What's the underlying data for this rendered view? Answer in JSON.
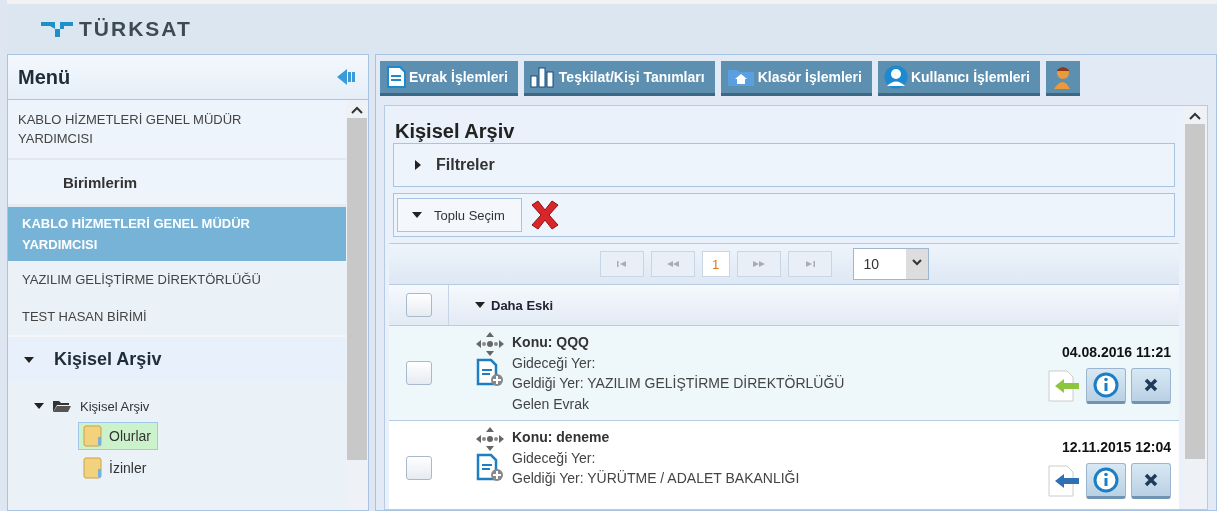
{
  "header": {
    "logo": "TÜRKSAT"
  },
  "sidebar": {
    "title": "Menü",
    "top_item": "KABLO HİZMETLERİ GENEL MÜDÜR YARDIMCISI",
    "units_title": "Birimlerim",
    "units": [
      {
        "label": "KABLO HİZMETLERİ GENEL MÜDÜR YARDIMCISI",
        "selected": true
      },
      {
        "label": "YAZILIM GELİŞTİRME DİREKTÖRLÜĞÜ",
        "selected": false
      },
      {
        "label": "TEST HASAN BİRİMİ",
        "selected": false
      }
    ],
    "archive": {
      "title": "Kişisel Arşiv",
      "expanded": true
    },
    "tree": [
      {
        "label": "Kişisel Arşiv",
        "expanded": true,
        "children": [
          {
            "label": "Olurlar",
            "selected": true
          },
          {
            "label": "İzinler",
            "selected": false
          }
        ]
      }
    ]
  },
  "tabs": [
    {
      "kind": "document",
      "label": "Evrak İşlemleri"
    },
    {
      "kind": "chart",
      "label": "Teşkilat/Kişi Tanımları"
    },
    {
      "kind": "folder",
      "label": "Klasör İşlemleri"
    },
    {
      "kind": "user",
      "label": "Kullanıcı İşlemleri"
    },
    {
      "kind": "person"
    }
  ],
  "content": {
    "title": "Kişisel Arşiv",
    "filters": {
      "label": "Filtreler",
      "expanded": false
    },
    "bulk_select": "Toplu Seçim",
    "pager": {
      "page": "1",
      "page_size": "10"
    },
    "group": {
      "label": "Daha Eski",
      "expanded": true,
      "checked": false
    },
    "rows": [
      {
        "checked": false,
        "subject": "Konu: QQQ",
        "to": "Gideceği Yer:",
        "from": "Geldiği Yer: YAZILIM GELİŞTİRME DİREKTÖRLÜĞÜ",
        "type": "Gelen Evrak",
        "date": "04.08.2016 11:21",
        "color": "#8cc63e"
      },
      {
        "checked": false,
        "subject": "Konu: deneme",
        "to": "Gideceği Yer:",
        "from": "Geldiği Yer: YÜRÜTME / ADALET BAKANLIĞI",
        "date": "12.11.2015 12:04",
        "color": "#2f6fb3"
      }
    ]
  }
}
